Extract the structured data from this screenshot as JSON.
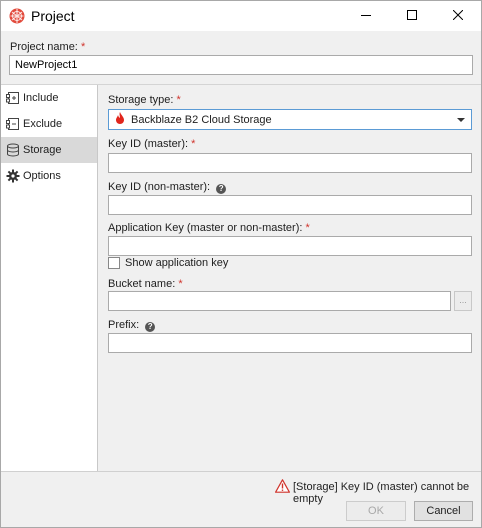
{
  "window": {
    "title": "Project",
    "icon": "grid-ball-icon",
    "accent_color": "#e2493b"
  },
  "project": {
    "label": "Project name:",
    "required_mark": "*",
    "value": "NewProject1"
  },
  "nav": {
    "items": [
      {
        "label": "Include",
        "icon": "include-icon",
        "active": false
      },
      {
        "label": "Exclude",
        "icon": "exclude-icon",
        "active": false
      },
      {
        "label": "Storage",
        "icon": "database-icon",
        "active": true
      },
      {
        "label": "Options",
        "icon": "gear-icon",
        "active": false
      }
    ]
  },
  "storage": {
    "type_label": "Storage type:",
    "type_value": "Backblaze B2 Cloud Storage",
    "type_icon": "backblaze-flame-icon",
    "key_id_master_label": "Key ID (master):",
    "key_id_master_value": "",
    "key_id_nonmaster_label": "Key ID (non-master):",
    "key_id_nonmaster_value": "",
    "app_key_label": "Application Key (master or non-master):",
    "app_key_value": "",
    "show_key_label": "Show application key",
    "show_key_checked": false,
    "bucket_label": "Bucket name:",
    "bucket_value": "",
    "browse_label": "...",
    "prefix_label": "Prefix:",
    "prefix_value": "",
    "required_mark": "*",
    "help_glyph": "?"
  },
  "footer": {
    "status_text": "[Storage] Key ID (master) cannot be empty",
    "warning_color": "#d0342c",
    "ok_label": "OK",
    "ok_enabled": false,
    "cancel_label": "Cancel"
  }
}
